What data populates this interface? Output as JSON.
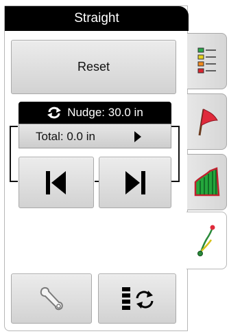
{
  "header": {
    "title": "Straight"
  },
  "controls": {
    "reset_label": "Reset",
    "nudge_label": "Nudge: 30.0 in",
    "total_label": "Total: 0.0 in"
  },
  "icons": {
    "nudge": "refresh-icon",
    "total_arrow": "play-arrow-icon",
    "step_back": "skip-back-icon",
    "step_forward": "skip-forward-icon",
    "settings": "wrench-icon",
    "swath": "swath-cycle-icon",
    "tab_layers": "layers-legend-icon",
    "tab_flag": "flag-icon",
    "tab_yield": "yield-map-icon",
    "tab_guidance": "guidance-line-icon"
  },
  "colors": {
    "title_bg": "#000000",
    "button_face": "#dcdcdc",
    "flag_red": "#e02a3b",
    "yield_green": "#24a63c"
  }
}
